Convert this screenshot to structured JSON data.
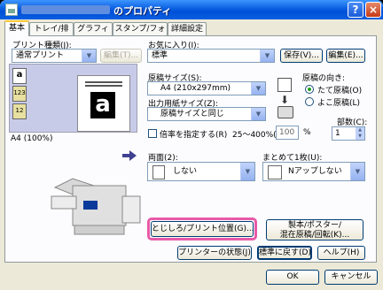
{
  "titlebar": {
    "title": "のプロパティ",
    "help": "?",
    "close": "×"
  },
  "tabs": [
    "基本",
    "トレイ/排出",
    "グラフィックス",
    "スタンプ/フォーム",
    "詳細設定"
  ],
  "left": {
    "print_type_label": "プリント種類(J):",
    "print_type_value": "通常プリント",
    "edit_button": "編集(T)...",
    "preview_caption": "A4 (100%)"
  },
  "favorites": {
    "label": "お気に入り(I):",
    "value": "標準",
    "save_button": "保存(V)...",
    "edit_button": "編集(E)..."
  },
  "paper": {
    "size_label": "原稿サイズ(S):",
    "size_value": "A4 (210x297mm)",
    "output_label": "出力用紙サイズ(Z):",
    "output_value": "原稿サイズと同じ",
    "scale_check_label": "倍率を指定する(R)",
    "scale_range": "25〜400%(A):",
    "scale_value": "100",
    "scale_unit": "%"
  },
  "orientation": {
    "label": "原稿の向き:",
    "portrait": "たて原稿(O)",
    "landscape": "よこ原稿(L)"
  },
  "copies": {
    "label": "部数(C):",
    "value": "1"
  },
  "duplex": {
    "label": "両面(2):",
    "value": "しない"
  },
  "nup": {
    "label": "まとめて1枚(U):",
    "value": "Nアップしない"
  },
  "buttons": {
    "binding": "とじしろ/プリント位置(G)...",
    "booklet_line1": "製本/ポスター/",
    "booklet_line2": "混在原稿/回転(K)...",
    "printer_status": "プリンターの状態(J)",
    "restore_defaults": "標準に戻す(D)",
    "help": "ヘルプ(H)",
    "ok": "OK",
    "cancel": "キャンセル"
  }
}
